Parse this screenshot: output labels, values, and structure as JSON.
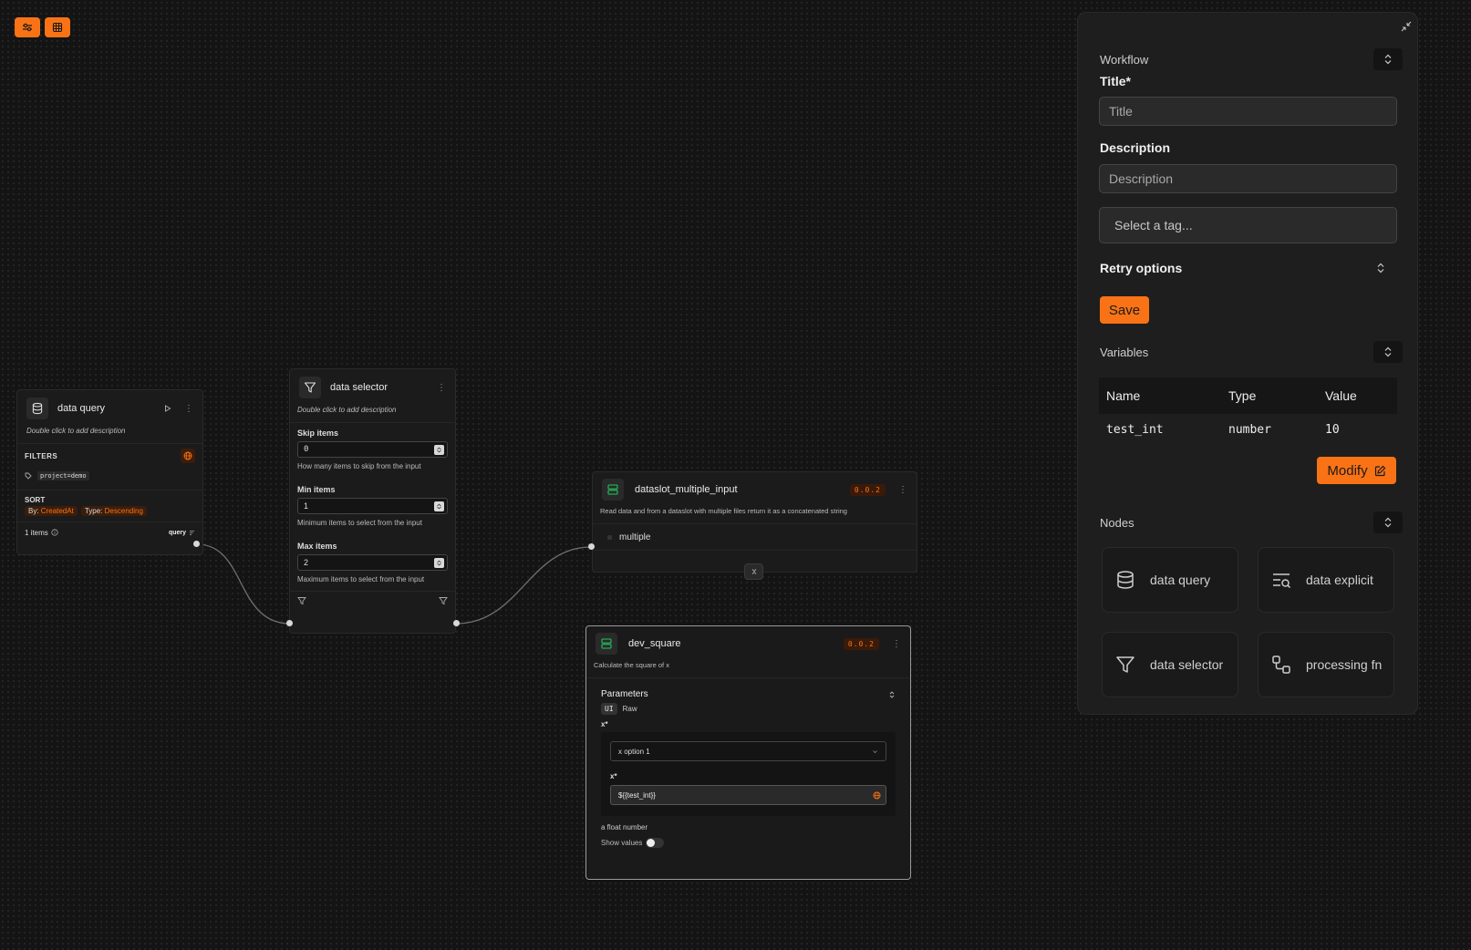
{
  "toolbar": {
    "settings_icon": "sliders-icon",
    "grid_icon": "grid-icon"
  },
  "data_query_node": {
    "title": "data query",
    "description": "Double click to add description",
    "filters_label": "FILTERS",
    "filter_tag": "project=demo",
    "sort_label": "SORT",
    "sort_by_prefix": "By:",
    "sort_by_value": "CreatedAt",
    "sort_type_prefix": "Type:",
    "sort_type_value": "Descending",
    "items_count": "1 items",
    "output_label": "query"
  },
  "data_selector_node": {
    "title": "data selector",
    "description": "Double click to add description",
    "skip": {
      "label": "Skip items",
      "value": "0",
      "help": "How many items to skip from the input"
    },
    "min": {
      "label": "Min items",
      "value": "1",
      "help": "Minimum items to select from the input"
    },
    "max": {
      "label": "Max items",
      "value": "2",
      "help": "Maximum items to select from the input"
    }
  },
  "dataslot_node": {
    "title": "dataslot_multiple_input",
    "version": "0.0.2",
    "description": "Read data and from a dataslot with multiple files return it as a concatenated string",
    "input_label": "multiple"
  },
  "dev_square_node": {
    "title": "dev_square",
    "version": "0.0.2",
    "description": "Calculate the square of x",
    "parameters_label": "Parameters",
    "tab_ui": "UI",
    "tab_raw": "Raw",
    "x_label": "x*",
    "x_select_value": "x option 1",
    "x_inner_label": "x*",
    "x_input_value": "${{test_int}}",
    "x_help": "a float number",
    "show_values_label": "Show values"
  },
  "panel": {
    "workflow_label": "Workflow",
    "title_label": "Title*",
    "title_placeholder": "Title",
    "description_label": "Description",
    "description_placeholder": "Description",
    "tag_placeholder": "Select a tag...",
    "retry_label": "Retry options",
    "save_label": "Save",
    "variables_label": "Variables",
    "variables_table": {
      "headers": [
        "Name",
        "Type",
        "Value"
      ],
      "rows": [
        [
          "test_int",
          "number",
          "10"
        ]
      ]
    },
    "modify_label": "Modify",
    "nodes_label": "Nodes",
    "node_items": [
      "data query",
      "data explicit",
      "data selector",
      "processing fn"
    ]
  },
  "colors": {
    "accent": "#f97316",
    "background": "#141414",
    "panel": "#1e1e1e"
  }
}
